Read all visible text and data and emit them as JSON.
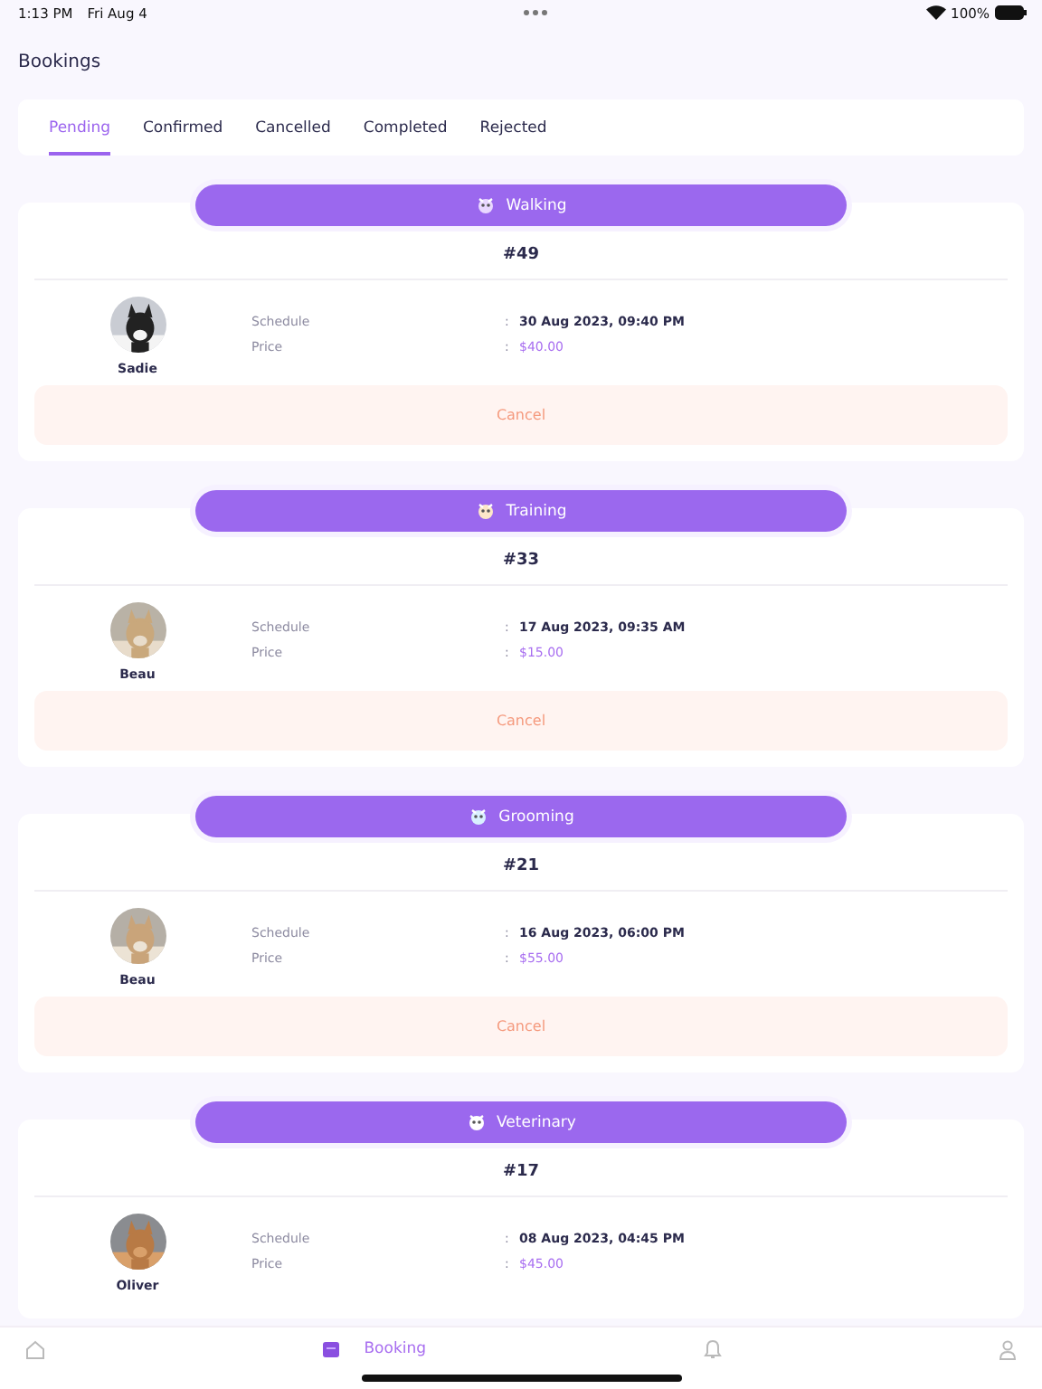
{
  "status_bar": {
    "time": "1:13 PM",
    "date": "Fri Aug 4",
    "battery": "100%"
  },
  "title": "Bookings",
  "tabs": [
    {
      "label": "Pending",
      "selected": true
    },
    {
      "label": "Confirmed",
      "selected": false
    },
    {
      "label": "Cancelled",
      "selected": false
    },
    {
      "label": "Completed",
      "selected": false
    },
    {
      "label": "Rejected",
      "selected": false
    }
  ],
  "bookings": [
    {
      "service": "Walking",
      "number": "#49",
      "pet": {
        "name": "Sadie"
      },
      "schedule_label": "Schedule",
      "schedule_sep": ":",
      "schedule": "30 Aug 2023, 09:40 PM",
      "price_label": "Price",
      "price_sep": ":",
      "price": "$40.00",
      "action": "Cancel"
    },
    {
      "service": "Training",
      "number": "#33",
      "pet": {
        "name": "Beau"
      },
      "schedule_label": "Schedule",
      "schedule_sep": ":",
      "schedule": "17 Aug 2023, 09:35 AM",
      "price_label": "Price",
      "price_sep": ":",
      "price": "$15.00",
      "action": "Cancel"
    },
    {
      "service": "Grooming",
      "number": "#21",
      "pet": {
        "name": "Beau"
      },
      "schedule_label": "Schedule",
      "schedule_sep": ":",
      "schedule": "16 Aug 2023, 06:00 PM",
      "price_label": "Price",
      "price_sep": ":",
      "price": "$55.00",
      "action": "Cancel"
    },
    {
      "service": "Veterinary",
      "number": "#17",
      "pet": {
        "name": "Oliver"
      },
      "schedule_label": "Schedule",
      "schedule_sep": ":",
      "schedule": "08 Aug 2023, 04:45 PM",
      "price_label": "Price",
      "price_sep": ":",
      "price": "$45.00"
    }
  ],
  "nav": [
    {
      "kind": "home",
      "selected": false
    },
    {
      "kind": "booking",
      "label": "Booking",
      "selected": true
    },
    {
      "kind": "bell",
      "selected": false
    },
    {
      "kind": "profile",
      "selected": false
    }
  ]
}
